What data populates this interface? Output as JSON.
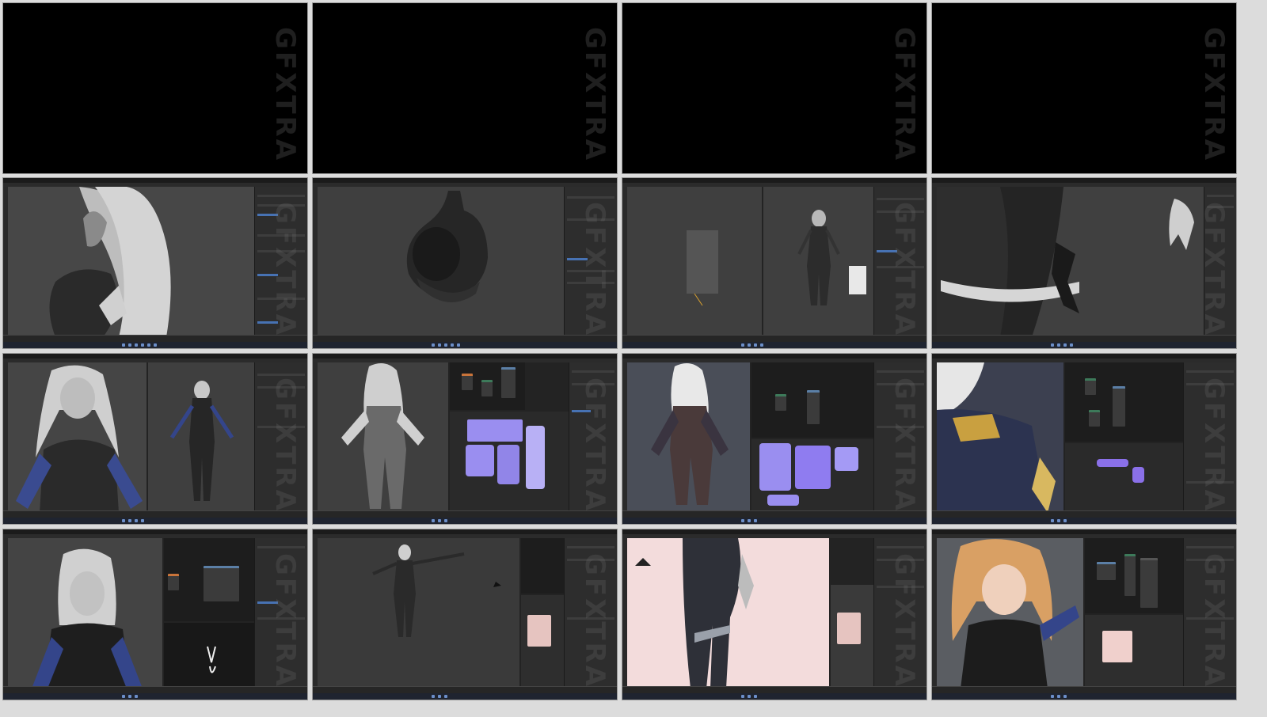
{
  "watermark": "GFXTRA",
  "colors": {
    "background": "#dcdcdc",
    "blender_ui": "#2d2d2d",
    "viewport": "#3f3f3f",
    "accent_blue": "#4772b3",
    "uv_island": "#9a8ef0"
  },
  "tiles": [
    {
      "content": "black-frame"
    },
    {
      "content": "black-frame"
    },
    {
      "content": "black-frame"
    },
    {
      "content": "black-frame"
    },
    {
      "content": "blender-sculpt-hair-closeup"
    },
    {
      "content": "blender-armor-chest-piece"
    },
    {
      "content": "blender-dual-viewport-character"
    },
    {
      "content": "blender-leg-strap-closeup"
    },
    {
      "content": "blender-dual-viewport-front-views"
    },
    {
      "content": "blender-uv-editing-body"
    },
    {
      "content": "blender-texture-painting-uv"
    },
    {
      "content": "blender-shading-closeup"
    },
    {
      "content": "blender-shader-nodes"
    },
    {
      "content": "blender-rigging-tpose"
    },
    {
      "content": "blender-pose-closeup-legs"
    },
    {
      "content": "blender-final-render-face"
    }
  ]
}
